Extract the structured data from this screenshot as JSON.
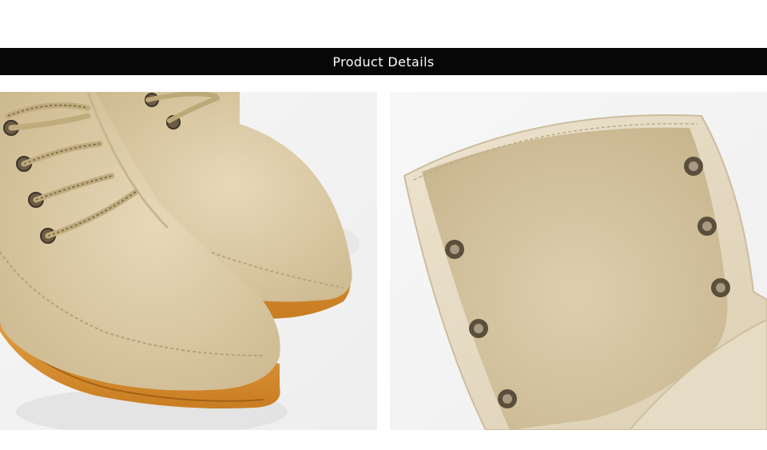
{
  "header": {
    "title": "Product Details"
  },
  "photos": [
    {
      "subject": "boot-toes-front"
    },
    {
      "subject": "boot-collar-eyelets"
    }
  ],
  "colors": {
    "banner": "#070707",
    "banner_text": "#ffffff",
    "suede": "#d9c9a6",
    "sole": "#d9912f",
    "lace": "#b9a475",
    "eyelet": "#5a4e3c"
  }
}
